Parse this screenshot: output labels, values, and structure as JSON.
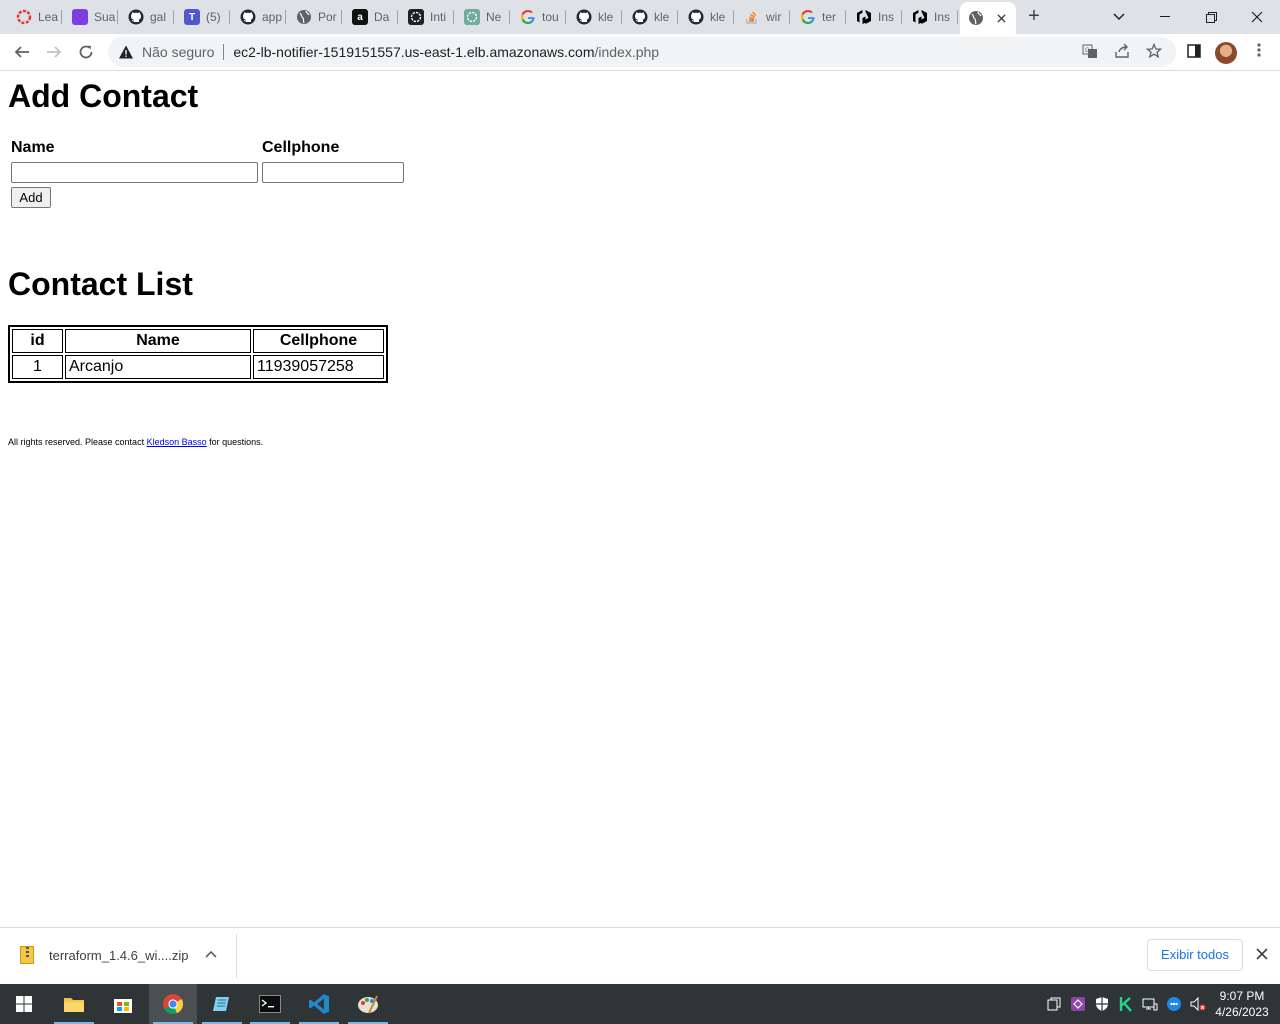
{
  "browser": {
    "tabs": [
      {
        "label": "Lea",
        "icon": "red-ring-icon",
        "color": "#e53935"
      },
      {
        "label": "Sua",
        "icon": "purple-app-icon",
        "color": "#7b3fe4"
      },
      {
        "label": "gal",
        "icon": "github-icon",
        "color": "#24292f"
      },
      {
        "label": "(5)",
        "icon": "teams-icon",
        "color": "#5059c9"
      },
      {
        "label": "app",
        "icon": "github-icon",
        "color": "#24292f"
      },
      {
        "label": "Por",
        "icon": "globe-icon",
        "color": "#5f6368"
      },
      {
        "label": "Da",
        "icon": "letter-a-icon",
        "color": "#111111"
      },
      {
        "label": "Inti",
        "icon": "openai-dark-icon",
        "color": "#202123"
      },
      {
        "label": "Ne",
        "icon": "openai-icon",
        "color": "#74aa9c"
      },
      {
        "label": "tou",
        "icon": "google-icon",
        "color": "#4285f4"
      },
      {
        "label": "kle",
        "icon": "github-icon",
        "color": "#24292f"
      },
      {
        "label": "kle",
        "icon": "github-icon",
        "color": "#24292f"
      },
      {
        "label": "kle",
        "icon": "github-icon",
        "color": "#24292f"
      },
      {
        "label": "wir",
        "icon": "stackoverflow-icon",
        "color": "#f48024"
      },
      {
        "label": "ter",
        "icon": "google-icon",
        "color": "#4285f4"
      },
      {
        "label": "Ins",
        "icon": "hashicorp-icon",
        "color": "#000000"
      },
      {
        "label": "Ins",
        "icon": "hashicorp-icon",
        "color": "#000000"
      },
      {
        "label": "",
        "icon": "globe-icon",
        "color": "#5f6368",
        "active": true
      }
    ],
    "security_label": "Não seguro",
    "url_host": "ec2-lb-notifier-1519151557.us-east-1.elb.amazonaws.com",
    "url_path": "/index.php"
  },
  "page": {
    "add_title": "Add Contact",
    "name_label": "Name",
    "cellphone_label": "Cellphone",
    "name_value": "",
    "cellphone_value": "",
    "add_button": "Add",
    "list_title": "Contact List",
    "table_headers": [
      "id",
      "Name",
      "Cellphone"
    ],
    "table_rows": [
      {
        "id": "1",
        "name": "Arcanjo",
        "cellphone": "11939057258"
      }
    ],
    "footer_prefix": "All rights reserved. Please contact ",
    "footer_link": "Kledson Basso",
    "footer_suffix": " for questions."
  },
  "downloads": {
    "file_name": "terraform_1.4.6_wi....zip",
    "show_all": "Exibir todos"
  },
  "taskbar": {
    "time": "9:07 PM",
    "date": "4/26/2023",
    "accent": "#76b9ed"
  }
}
